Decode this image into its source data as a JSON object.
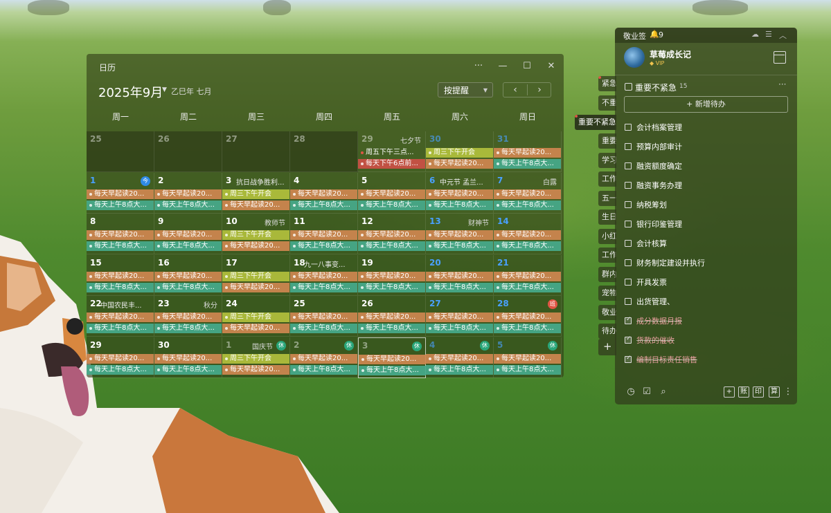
{
  "calendar": {
    "title": "日历",
    "month": "2025年9月",
    "lunar": "乙巳年 七月",
    "remind_label": "按提醒",
    "weekdays": [
      "周一",
      "周二",
      "周三",
      "周四",
      "周五",
      "周六",
      "周日"
    ],
    "rows": [
      [
        {
          "d": "25",
          "dim": true
        },
        {
          "d": "26",
          "dim": true
        },
        {
          "d": "27",
          "dim": true
        },
        {
          "d": "28",
          "dim": true
        },
        {
          "d": "29",
          "dim": true,
          "fest": "七夕节",
          "events": [
            [
              "plain",
              "周五下午三点..."
            ],
            [
              "red",
              "每天下午6点前..."
            ]
          ]
        },
        {
          "d": "30",
          "dim": true,
          "blue": true,
          "events": [
            [
              "lime",
              "周三下午开会"
            ],
            [
              "orange",
              "每天早起读20..."
            ]
          ]
        },
        {
          "d": "31",
          "dim": true,
          "blue": true,
          "events": [
            [
              "orange",
              "每天早起读20..."
            ],
            [
              "teal",
              "每天上午8点大..."
            ]
          ]
        }
      ],
      [
        {
          "d": "1",
          "blue": true,
          "badge": "今",
          "badgeColor": "blue",
          "events": [
            [
              "orange",
              "每天早起读20..."
            ],
            [
              "teal",
              "每天上午8点大..."
            ]
          ]
        },
        {
          "d": "2",
          "events": [
            [
              "orange",
              "每天早起读20..."
            ],
            [
              "teal",
              "每天上午8点大..."
            ]
          ]
        },
        {
          "d": "3",
          "fest": "抗日战争胜利...",
          "festLeft": true,
          "events": [
            [
              "lime",
              "周三下午开会"
            ],
            [
              "orange",
              "每天早起读20..."
            ]
          ]
        },
        {
          "d": "4",
          "events": [
            [
              "orange",
              "每天早起读20..."
            ],
            [
              "teal",
              "每天上午8点大..."
            ]
          ]
        },
        {
          "d": "5",
          "events": [
            [
              "orange",
              "每天早起读20..."
            ],
            [
              "teal",
              "每天上午8点大..."
            ]
          ]
        },
        {
          "d": "6",
          "blue": true,
          "fest": "中元节 孟兰...",
          "festLeft": true,
          "events": [
            [
              "orange",
              "每天早起读20..."
            ],
            [
              "teal",
              "每天上午8点大..."
            ]
          ]
        },
        {
          "d": "7",
          "blue": true,
          "fest": "白露",
          "events": [
            [
              "orange",
              "每天早起读20..."
            ],
            [
              "teal",
              "每天上午8点大..."
            ]
          ]
        }
      ],
      [
        {
          "d": "8",
          "events": [
            [
              "orange",
              "每天早起读20..."
            ],
            [
              "teal",
              "每天上午8点大..."
            ]
          ]
        },
        {
          "d": "9",
          "events": [
            [
              "orange",
              "每天早起读20..."
            ],
            [
              "teal",
              "每天上午8点大..."
            ]
          ]
        },
        {
          "d": "10",
          "fest": "教师节",
          "events": [
            [
              "lime",
              "周三下午开会"
            ],
            [
              "orange",
              "每天早起读20..."
            ]
          ]
        },
        {
          "d": "11",
          "events": [
            [
              "orange",
              "每天早起读20..."
            ],
            [
              "teal",
              "每天上午8点大..."
            ]
          ]
        },
        {
          "d": "12",
          "events": [
            [
              "orange",
              "每天早起读20..."
            ],
            [
              "teal",
              "每天上午8点大..."
            ]
          ]
        },
        {
          "d": "13",
          "blue": true,
          "fest": "财神节",
          "events": [
            [
              "orange",
              "每天早起读20..."
            ],
            [
              "teal",
              "每天上午8点大..."
            ]
          ]
        },
        {
          "d": "14",
          "blue": true,
          "events": [
            [
              "orange",
              "每天早起读20..."
            ],
            [
              "teal",
              "每天上午8点大..."
            ]
          ]
        }
      ],
      [
        {
          "d": "15",
          "events": [
            [
              "orange",
              "每天早起读20..."
            ],
            [
              "teal",
              "每天上午8点大..."
            ]
          ]
        },
        {
          "d": "16",
          "events": [
            [
              "orange",
              "每天早起读20..."
            ],
            [
              "teal",
              "每天上午8点大..."
            ]
          ]
        },
        {
          "d": "17",
          "events": [
            [
              "lime",
              "周三下午开会"
            ],
            [
              "orange",
              "每天早起读20..."
            ]
          ]
        },
        {
          "d": "18",
          "fest": "九一八事变...",
          "festLeft": true,
          "events": [
            [
              "orange",
              "每天早起读20..."
            ],
            [
              "teal",
              "每天上午8点大..."
            ]
          ]
        },
        {
          "d": "19",
          "events": [
            [
              "orange",
              "每天早起读20..."
            ],
            [
              "teal",
              "每天上午8点大..."
            ]
          ]
        },
        {
          "d": "20",
          "blue": true,
          "events": [
            [
              "orange",
              "每天早起读20..."
            ],
            [
              "teal",
              "每天上午8点大..."
            ]
          ]
        },
        {
          "d": "21",
          "blue": true,
          "events": [
            [
              "orange",
              "每天早起读20..."
            ],
            [
              "teal",
              "每天上午8点大..."
            ]
          ]
        }
      ],
      [
        {
          "d": "22",
          "fest": "中国农民丰...",
          "festLeft": true,
          "events": [
            [
              "orange",
              "每天早起读20..."
            ],
            [
              "teal",
              "每天上午8点大..."
            ]
          ]
        },
        {
          "d": "23",
          "fest": "秋分",
          "events": [
            [
              "orange",
              "每天早起读20..."
            ],
            [
              "teal",
              "每天上午8点大..."
            ]
          ]
        },
        {
          "d": "24",
          "events": [
            [
              "lime",
              "周三下午开会"
            ],
            [
              "orange",
              "每天早起读20..."
            ]
          ]
        },
        {
          "d": "25",
          "events": [
            [
              "orange",
              "每天早起读20..."
            ],
            [
              "teal",
              "每天上午8点大..."
            ]
          ]
        },
        {
          "d": "26",
          "events": [
            [
              "orange",
              "每天早起读20..."
            ],
            [
              "teal",
              "每天上午8点大..."
            ]
          ]
        },
        {
          "d": "27",
          "blue": true,
          "events": [
            [
              "orange",
              "每天早起读20..."
            ],
            [
              "teal",
              "每天上午8点大..."
            ]
          ]
        },
        {
          "d": "28",
          "blue": true,
          "badge": "班",
          "badgeColor": "red",
          "events": [
            [
              "orange",
              "每天早起读20..."
            ],
            [
              "teal",
              "每天上午8点大..."
            ]
          ]
        }
      ],
      [
        {
          "d": "29",
          "events": [
            [
              "orange",
              "每天早起读20..."
            ],
            [
              "teal",
              "每天上午8点大..."
            ]
          ]
        },
        {
          "d": "30",
          "events": [
            [
              "orange",
              "每天早起读20..."
            ],
            [
              "teal",
              "每天上午8点大..."
            ]
          ]
        },
        {
          "d": "1",
          "dim": true,
          "fest": "国庆节",
          "badge": "休",
          "badgeColor": "green",
          "festShift": true,
          "events": [
            [
              "lime",
              "周三下午开会"
            ],
            [
              "orange",
              "每天早起读20..."
            ]
          ]
        },
        {
          "d": "2",
          "dim": true,
          "badge": "休",
          "badgeColor": "green",
          "events": [
            [
              "orange",
              "每天早起读20..."
            ],
            [
              "teal",
              "每天上午8点大..."
            ]
          ]
        },
        {
          "d": "3",
          "dim": true,
          "badge": "休",
          "badgeColor": "green",
          "today": true,
          "events": [
            [
              "orange",
              "每天早起读20..."
            ],
            [
              "teal",
              "每天上午8点大..."
            ]
          ]
        },
        {
          "d": "4",
          "dim": true,
          "blue": true,
          "badge": "休",
          "badgeColor": "green",
          "events": [
            [
              "orange",
              "每天早起读20..."
            ],
            [
              "teal",
              "每天上午8点大..."
            ]
          ]
        },
        {
          "d": "5",
          "dim": true,
          "blue": true,
          "badge": "休",
          "badgeColor": "green",
          "events": [
            [
              "orange",
              "每天早起读20..."
            ],
            [
              "teal",
              "每天上午8点大..."
            ]
          ]
        }
      ]
    ]
  },
  "side_tabs": [
    "紧急",
    "不重",
    "重要不紧急",
    "重要",
    "学习",
    "工作",
    "五一",
    "生日",
    "小红",
    "工作",
    "群内",
    "宠物",
    "敬业",
    "待办",
    "+"
  ],
  "note": {
    "title": "敬业签",
    "bell_count": "9",
    "username": "草莓成长记",
    "vip": "VIP",
    "group_title": "重要不紧急",
    "group_count": "15",
    "add_label": "+ 新增待办",
    "todos": [
      {
        "text": "会计档案管理",
        "done": false
      },
      {
        "text": "预算内部审计",
        "done": false
      },
      {
        "text": "融资额度确定",
        "done": false
      },
      {
        "text": "融资事务办理",
        "done": false
      },
      {
        "text": "纳税筹划",
        "done": false
      },
      {
        "text": "银行印鉴管理",
        "done": false
      },
      {
        "text": "会计核算",
        "done": false
      },
      {
        "text": "财务制定建设并执行",
        "done": false
      },
      {
        "text": "开具发票",
        "done": false
      },
      {
        "text": "出货管理、",
        "done": false
      },
      {
        "text": "成分数据月报",
        "done": true
      },
      {
        "text": "货款的催收",
        "done": true
      },
      {
        "text": "编制目标责任销售",
        "done": true
      }
    ],
    "footer_boxes": [
      "+",
      "账",
      "印",
      "算"
    ]
  },
  "colors": {
    "orange": "#cf8750",
    "teal": "#46aa8c",
    "lime": "#afbe3c",
    "red": "#c85046",
    "blue": "#49a0ff"
  }
}
